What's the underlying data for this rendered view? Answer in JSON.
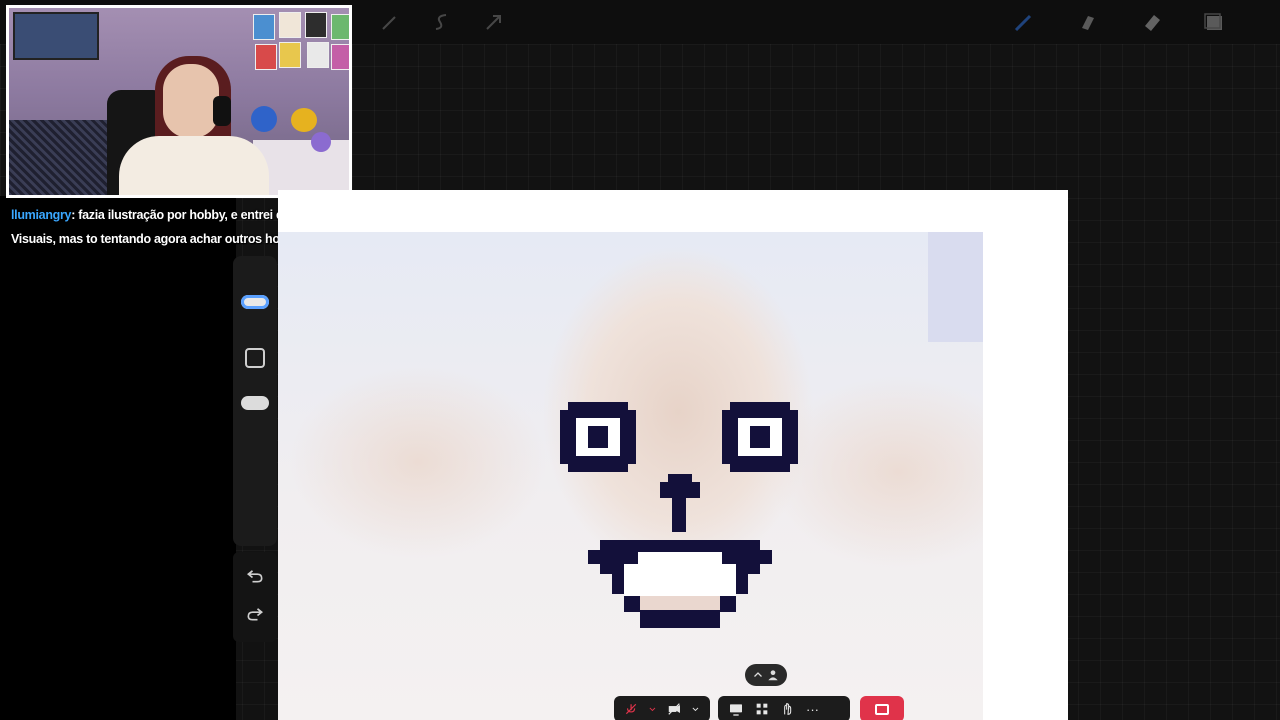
{
  "chat": {
    "username": "llumiangry",
    "separator": ":",
    "message": " fazia ilustração por hobby, e entrei em Artes Visuais, mas to tentando agora achar outros hobbys"
  },
  "top_toolbar": {
    "icons": [
      "wrench-icon",
      "magic-wand-icon",
      "selection-icon",
      "move-arrow-icon",
      "brush-icon",
      "smudge-icon",
      "eraser-icon",
      "layers-icon"
    ]
  },
  "sidebar": {
    "icons": [
      "brush-size-slider",
      "modify-square-icon",
      "opacity-slider",
      "undo-icon",
      "redo-icon"
    ]
  },
  "meeting_toolbar": {
    "icons": [
      "mic-off-icon",
      "video-off-icon",
      "share-screen-icon",
      "apps-icon",
      "reactions-icon",
      "more-icon",
      "leave-call-icon"
    ],
    "more_label": "···"
  },
  "colors": {
    "accent": "#3aa7ff",
    "pixel_ink": "#13103a",
    "leave": "#e0334a"
  }
}
